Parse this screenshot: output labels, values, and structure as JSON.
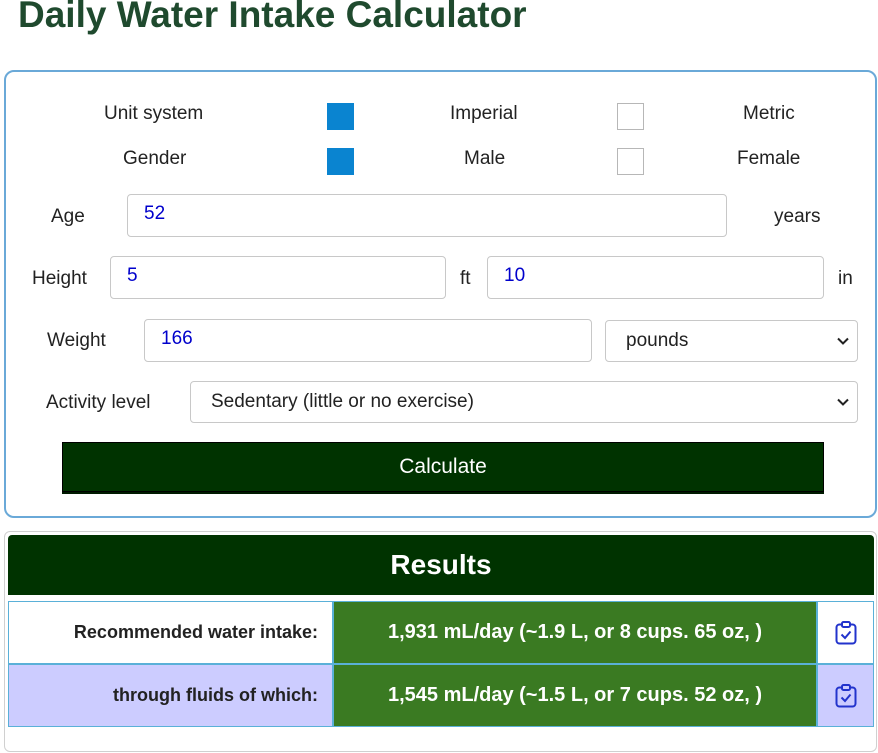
{
  "title": "Daily Water Intake Calculator",
  "form": {
    "unit_system": {
      "label": "Unit system",
      "options": [
        "Imperial",
        "Metric"
      ],
      "selected": "Imperial"
    },
    "gender": {
      "label": "Gender",
      "options": [
        "Male",
        "Female"
      ],
      "selected": "Male"
    },
    "age": {
      "label": "Age",
      "value": "52",
      "unit": "years"
    },
    "height": {
      "label": "Height",
      "feet": "5",
      "feet_unit": "ft",
      "inches": "10",
      "inches_unit": "in"
    },
    "weight": {
      "label": "Weight",
      "value": "166",
      "unit_selected": "pounds"
    },
    "activity": {
      "label": "Activity level",
      "selected": "Sedentary (little or no exercise)"
    },
    "calculate_label": "Calculate"
  },
  "results": {
    "heading": "Results",
    "rows": [
      {
        "label": "Recommended water intake:",
        "value": "1,931 mL/day (~1.9 L, or 8 cups. 65 oz, )"
      },
      {
        "label": "through fluids of which:",
        "value": "1,545 mL/day (~1.5 L, or 7 cups. 52 oz, )"
      }
    ]
  },
  "colors": {
    "title": "#1f4a2e",
    "accent_dark_green": "#003300",
    "result_green": "#3a7a22",
    "checkbox_blue": "#0a84d0",
    "row2_bg": "#ccccff",
    "panel_border": "#6aa9d8"
  },
  "icons": {
    "copy": "clipboard-check-icon",
    "dropdown": "chevron-down-icon"
  }
}
